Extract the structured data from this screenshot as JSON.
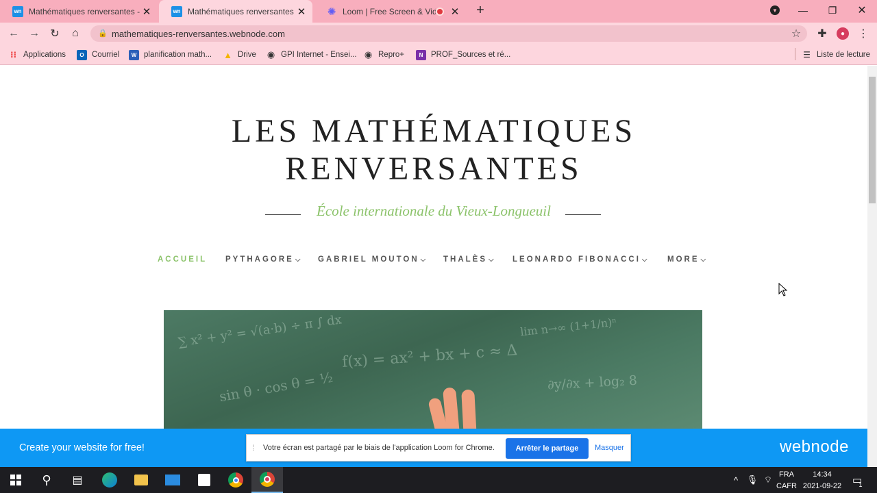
{
  "browser": {
    "tabs": [
      {
        "title": "Mathématiques renversantes - M",
        "favicon": "webnode-icon"
      },
      {
        "title": "Mathématiques renversantes",
        "favicon": "webnode-icon"
      },
      {
        "title": "Loom | Free Screen & Video",
        "favicon": "loom-icon"
      }
    ],
    "url": "mathematiques-renversantes.webnode.com",
    "bookmarks": [
      {
        "label": "Applications"
      },
      {
        "label": "Courriel"
      },
      {
        "label": "planification math..."
      },
      {
        "label": "Drive"
      },
      {
        "label": "GPI Internet - Ensei..."
      },
      {
        "label": "Repro+"
      },
      {
        "label": "PROF_Sources et ré..."
      }
    ],
    "reading_list": "Liste de lecture"
  },
  "site": {
    "title_line1": "LES MATHÉMATIQUES",
    "title_line2": "RENVERSANTES",
    "subtitle": "École internationale du Vieux-Longueuil",
    "nav": [
      {
        "label": "ACCUEIL"
      },
      {
        "label": "PYTHAGORE"
      },
      {
        "label": "GABRIEL MOUTON"
      },
      {
        "label": "THALÈS"
      },
      {
        "label": "LEONARDO FIBONACCI"
      },
      {
        "label": "MORE"
      }
    ],
    "accent_color": "#8cc36b"
  },
  "webnode_bar": {
    "cta": "Create your website for free!",
    "logo": "webnode",
    "color": "#0e98f4"
  },
  "loom_banner": {
    "message": "Votre écran est partagé par le biais de l'application Loom for Chrome.",
    "stop_label": "Arrêter le partage",
    "hide_label": "Masquer"
  },
  "taskbar": {
    "language_top": "FRA",
    "language_bottom": "CAFR",
    "time": "14:34",
    "date": "2021-09-22",
    "notification_count": "1"
  }
}
